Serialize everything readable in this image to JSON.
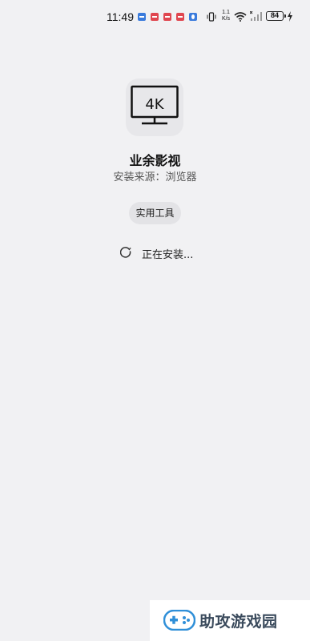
{
  "status_bar": {
    "time": "11:49",
    "net_speed_value": "1.1",
    "net_speed_unit": "K/s",
    "battery": "84"
  },
  "app": {
    "name": "业余影视",
    "source": "安装来源：浏览器",
    "category": "实用工具",
    "icon_label": "4K"
  },
  "install": {
    "status": "正在安装..."
  },
  "watermark": {
    "text": "助攻游戏园"
  },
  "colors": {
    "background": "#f1f1f3",
    "notif_blue": "#3a7bdc",
    "notif_red": "#e0464f"
  }
}
